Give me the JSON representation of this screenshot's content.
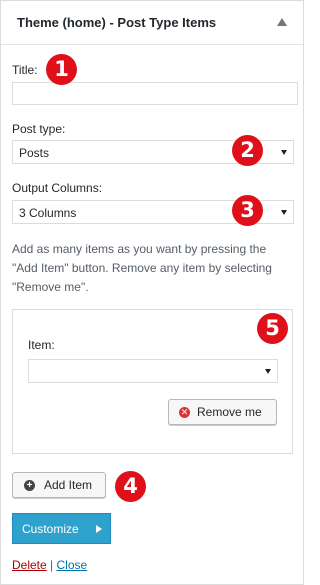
{
  "widget": {
    "title": "Theme (home) - Post Type Items"
  },
  "fields": {
    "title": {
      "label": "Title:",
      "value": ""
    },
    "post_type": {
      "label": "Post type:",
      "selected": "Posts"
    },
    "output_columns": {
      "label": "Output Columns:",
      "selected": "3 Columns"
    }
  },
  "help_text": "Add as many items as you want by pressing the \"Add Item\" button. Remove any item by selecting \"Remove me\".",
  "repeater": {
    "item_label": "Item:",
    "item_selected": "",
    "remove_label": "Remove me"
  },
  "add_item_label": "Add Item",
  "customize_label": "Customize",
  "footer": {
    "delete_label": "Delete",
    "separator": "|",
    "close_label": "Close"
  },
  "badges": [
    "1",
    "2",
    "3",
    "4",
    "5"
  ],
  "colors": {
    "badge": "#e0101a",
    "customize": "#2ea2cc",
    "delete_link": "#aa0000",
    "close_link": "#0073aa"
  }
}
